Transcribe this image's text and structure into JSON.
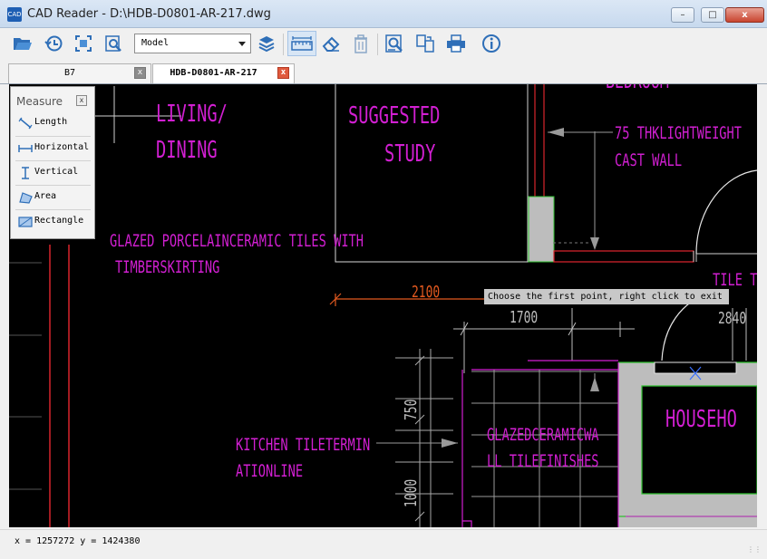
{
  "window": {
    "title": "CAD Reader - D:\\HDB-D0801-AR-217.dwg",
    "icon_text": "CAD",
    "minimize": "–",
    "maximize": "□",
    "close": "x"
  },
  "toolbar": {
    "icons": [
      "open-folder-icon",
      "recent-icon",
      "fit-screen-icon",
      "zoom-window-icon",
      "layers-icon",
      "measure-ruler-icon",
      "eraser-icon",
      "trash-icon",
      "find-text-icon",
      "convert-icon",
      "print-icon",
      "info-icon"
    ],
    "layout_select": "Model"
  },
  "tabs": [
    {
      "label": "B7",
      "active": false
    },
    {
      "label": "HDB-D0801-AR-217",
      "active": true
    }
  ],
  "measure_panel": {
    "title": "Measure",
    "close": "x",
    "items": [
      {
        "label": "Length",
        "icon": "length-icon"
      },
      {
        "label": "Horizontal",
        "icon": "horizontal-icon"
      },
      {
        "label": "Vertical",
        "icon": "vertical-icon"
      },
      {
        "label": "Area",
        "icon": "area-icon"
      },
      {
        "label": "Rectangle",
        "icon": "rectangle-icon"
      }
    ]
  },
  "tooltip": "Choose the first point, right click to exit",
  "drawing_text": {
    "bedroom": "BEDROOM",
    "living": "LIVING/",
    "dining": "DINING",
    "suggested": "SUGGESTED",
    "study": "STUDY",
    "thk_wall": "75 THKLIGHTWEIGHT",
    "cast_wall": "CAST WALL",
    "glazed_porcelain": "GLAZED PORCELAINCERAMIC TILES WITH",
    "timber": "TIMBERSKIRTING",
    "dim_2100": "2100",
    "dim_1700": "1700",
    "tile_t": "TILE T",
    "dim_2840": "2840",
    "dim_750": "750",
    "dim_1000": "1000",
    "kitchen1": "KITCHEN TILETERMIN",
    "kitchen2": "ATIONLINE",
    "glazed_ceramic": "GLAZEDCERAMICWA",
    "tile_finishes": "LL TILEFINISHES",
    "household": "HOUSEHO"
  },
  "colors": {
    "magenta": "#d21fd2",
    "orange": "#e2591f",
    "red": "#d8242c",
    "green": "#2fbf2f",
    "canvas": "#000000"
  },
  "status": {
    "coords": "x = 1257272 y = 1424380"
  }
}
